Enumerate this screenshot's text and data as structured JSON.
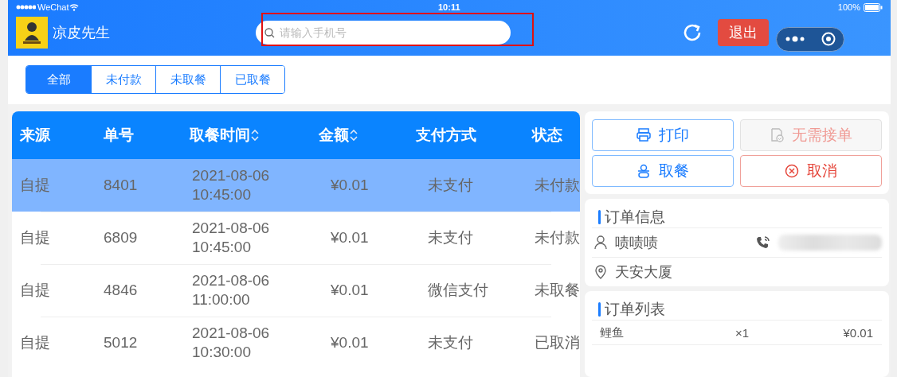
{
  "status_bar": {
    "carrier": "WeChat",
    "time": "10:11",
    "battery": "100%"
  },
  "header": {
    "shop_name": "凉皮先生",
    "search": {
      "placeholder": "请输入手机号",
      "highlighted": true
    },
    "logout": "退出"
  },
  "tabs": [
    {
      "label": "全部",
      "selected": true
    },
    {
      "label": "未付款",
      "selected": false
    },
    {
      "label": "未取餐",
      "selected": false
    },
    {
      "label": "已取餐",
      "selected": false
    }
  ],
  "table": {
    "columns": [
      {
        "label": "来源",
        "sortable": false
      },
      {
        "label": "单号",
        "sortable": false
      },
      {
        "label": "取餐时间",
        "sortable": true
      },
      {
        "label": "金额",
        "sortable": true
      },
      {
        "label": "支付方式",
        "sortable": false
      },
      {
        "label": "状态",
        "sortable": false
      }
    ],
    "rows": [
      {
        "selected": true,
        "cells": [
          "自提",
          "8401",
          "2021-08-06 10:45:00",
          "¥0.01",
          "未支付",
          "未付款"
        ]
      },
      {
        "selected": false,
        "cells": [
          "自提",
          "6809",
          "2021-08-06 10:45:00",
          "¥0.01",
          "未支付",
          "未付款"
        ]
      },
      {
        "selected": false,
        "cells": [
          "自提",
          "4846",
          "2021-08-06 11:00:00",
          "¥0.01",
          "微信支付",
          "未取餐"
        ]
      },
      {
        "selected": false,
        "cells": [
          "自提",
          "5012",
          "2021-08-06 10:30:00",
          "¥0.01",
          "未支付",
          "已取消"
        ]
      }
    ]
  },
  "actions": [
    {
      "label": "打印",
      "kind": "print",
      "disabled": false
    },
    {
      "label": "无需接单",
      "kind": "no-accept",
      "disabled": true
    },
    {
      "label": "取餐",
      "kind": "pickup",
      "disabled": false
    },
    {
      "label": "取消",
      "kind": "cancel",
      "disabled": false
    }
  ],
  "order_info": {
    "title": "订单信息",
    "customer": "啧啧啧",
    "address": "天安大厦"
  },
  "order_list": {
    "title": "订单列表",
    "items": [
      {
        "name": "鲤鱼",
        "qty": "×1",
        "price": "¥0.01"
      }
    ]
  }
}
